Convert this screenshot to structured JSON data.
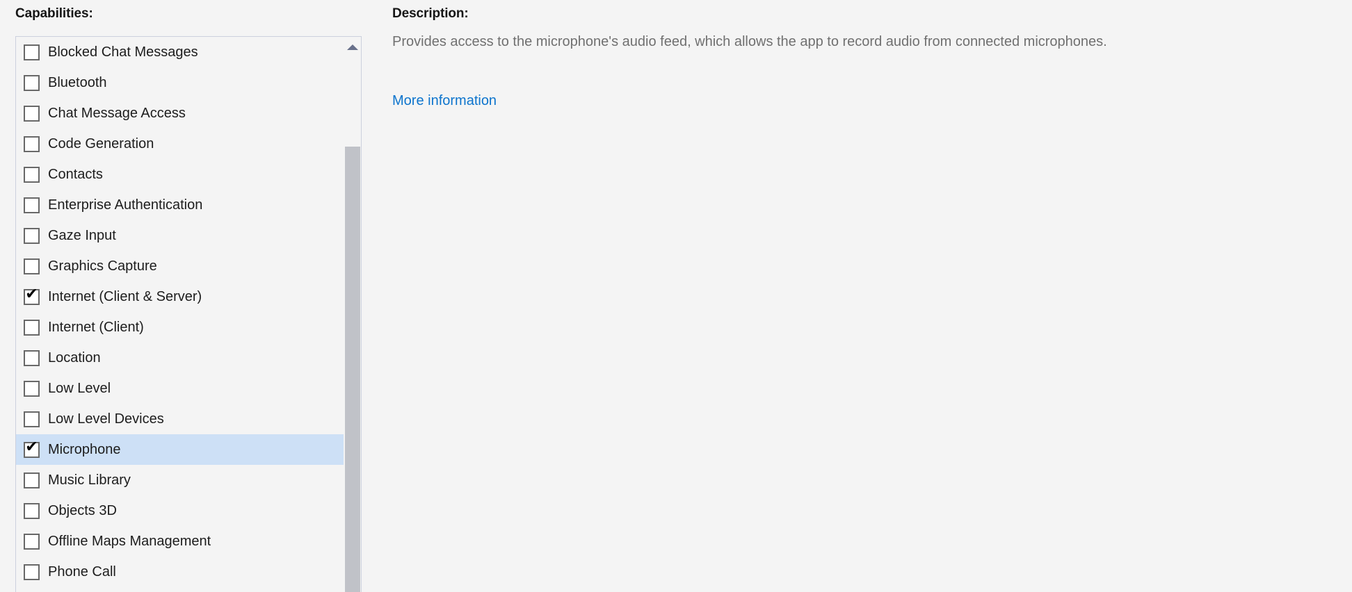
{
  "capabilities": {
    "heading": "Capabilities:",
    "scrollbar": {
      "up_arrow_icon": "chevron-up-icon",
      "thumb_name": "scrollbar-thumb"
    },
    "items": [
      {
        "label": "Blocked Chat Messages",
        "checked": false,
        "selected": false
      },
      {
        "label": "Bluetooth",
        "checked": false,
        "selected": false
      },
      {
        "label": "Chat Message Access",
        "checked": false,
        "selected": false
      },
      {
        "label": "Code Generation",
        "checked": false,
        "selected": false
      },
      {
        "label": "Contacts",
        "checked": false,
        "selected": false
      },
      {
        "label": "Enterprise Authentication",
        "checked": false,
        "selected": false
      },
      {
        "label": "Gaze Input",
        "checked": false,
        "selected": false
      },
      {
        "label": "Graphics Capture",
        "checked": false,
        "selected": false
      },
      {
        "label": "Internet (Client & Server)",
        "checked": true,
        "selected": false
      },
      {
        "label": "Internet (Client)",
        "checked": false,
        "selected": false
      },
      {
        "label": "Location",
        "checked": false,
        "selected": false
      },
      {
        "label": "Low Level",
        "checked": false,
        "selected": false
      },
      {
        "label": "Low Level Devices",
        "checked": false,
        "selected": false
      },
      {
        "label": "Microphone",
        "checked": true,
        "selected": true
      },
      {
        "label": "Music Library",
        "checked": false,
        "selected": false
      },
      {
        "label": "Objects 3D",
        "checked": false,
        "selected": false
      },
      {
        "label": "Offline Maps Management",
        "checked": false,
        "selected": false
      },
      {
        "label": "Phone Call",
        "checked": false,
        "selected": false
      }
    ],
    "checkmark_glyph": "✔"
  },
  "description": {
    "heading": "Description:",
    "body": "Provides access to the microphone's audio feed, which allows the app to record audio from connected microphones.",
    "link_label": "More information"
  },
  "colors": {
    "page_background": "#f4f4f4",
    "selection_highlight": "#cde0f6",
    "link": "#0d74cd",
    "description_text": "#707070",
    "listbox_border": "#ccd0dd",
    "scrollbar_thumb": "#c0c2c8",
    "checkbox_border": "#696969"
  }
}
